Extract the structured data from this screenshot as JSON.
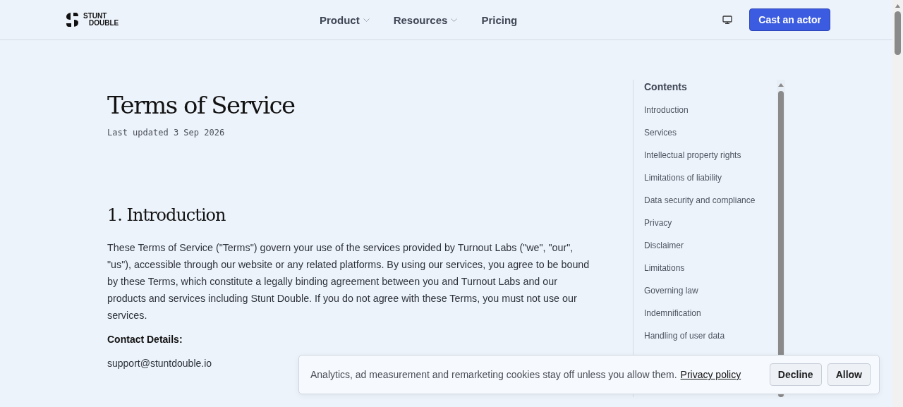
{
  "header": {
    "logo": [
      "STUNT",
      "DOUBLE"
    ],
    "nav": [
      {
        "label": "Product",
        "dropdown": true
      },
      {
        "label": "Resources",
        "dropdown": true
      },
      {
        "label": "Pricing",
        "dropdown": false
      }
    ],
    "cta": "Cast an actor"
  },
  "article": {
    "title": "Terms of Service",
    "updated": "Last updated 3 Sep 2026",
    "section_heading": "1. Introduction",
    "paragraph": "These Terms of Service (\"Terms\") govern your use of the services provided by Turnout Labs (\"we\", \"our\", \"us\"), accessible through our website or any related platforms. By using our services, you agree to be bound by these Terms, which constitute a legally binding agreement between you and Turnout Labs and our products and services including Stunt Double. If you do not agree with these Terms, you must not use our services.",
    "contact_label": "Contact Details:",
    "contact_email": "support@stuntdouble.io"
  },
  "contents": {
    "title": "Contents",
    "items": [
      "Introduction",
      "Services",
      "Intellectual property rights",
      "Limitations of liability",
      "Data security and compliance",
      "Privacy",
      "Disclaimer",
      "Limitations",
      "Governing law",
      "Indemnification",
      "Handling of user data"
    ]
  },
  "cookie_banner": {
    "text": "Analytics, ad measurement and remarketing cookies stay off unless you allow them.",
    "link": "Privacy policy",
    "buttons": [
      "Decline",
      "Allow"
    ]
  }
}
